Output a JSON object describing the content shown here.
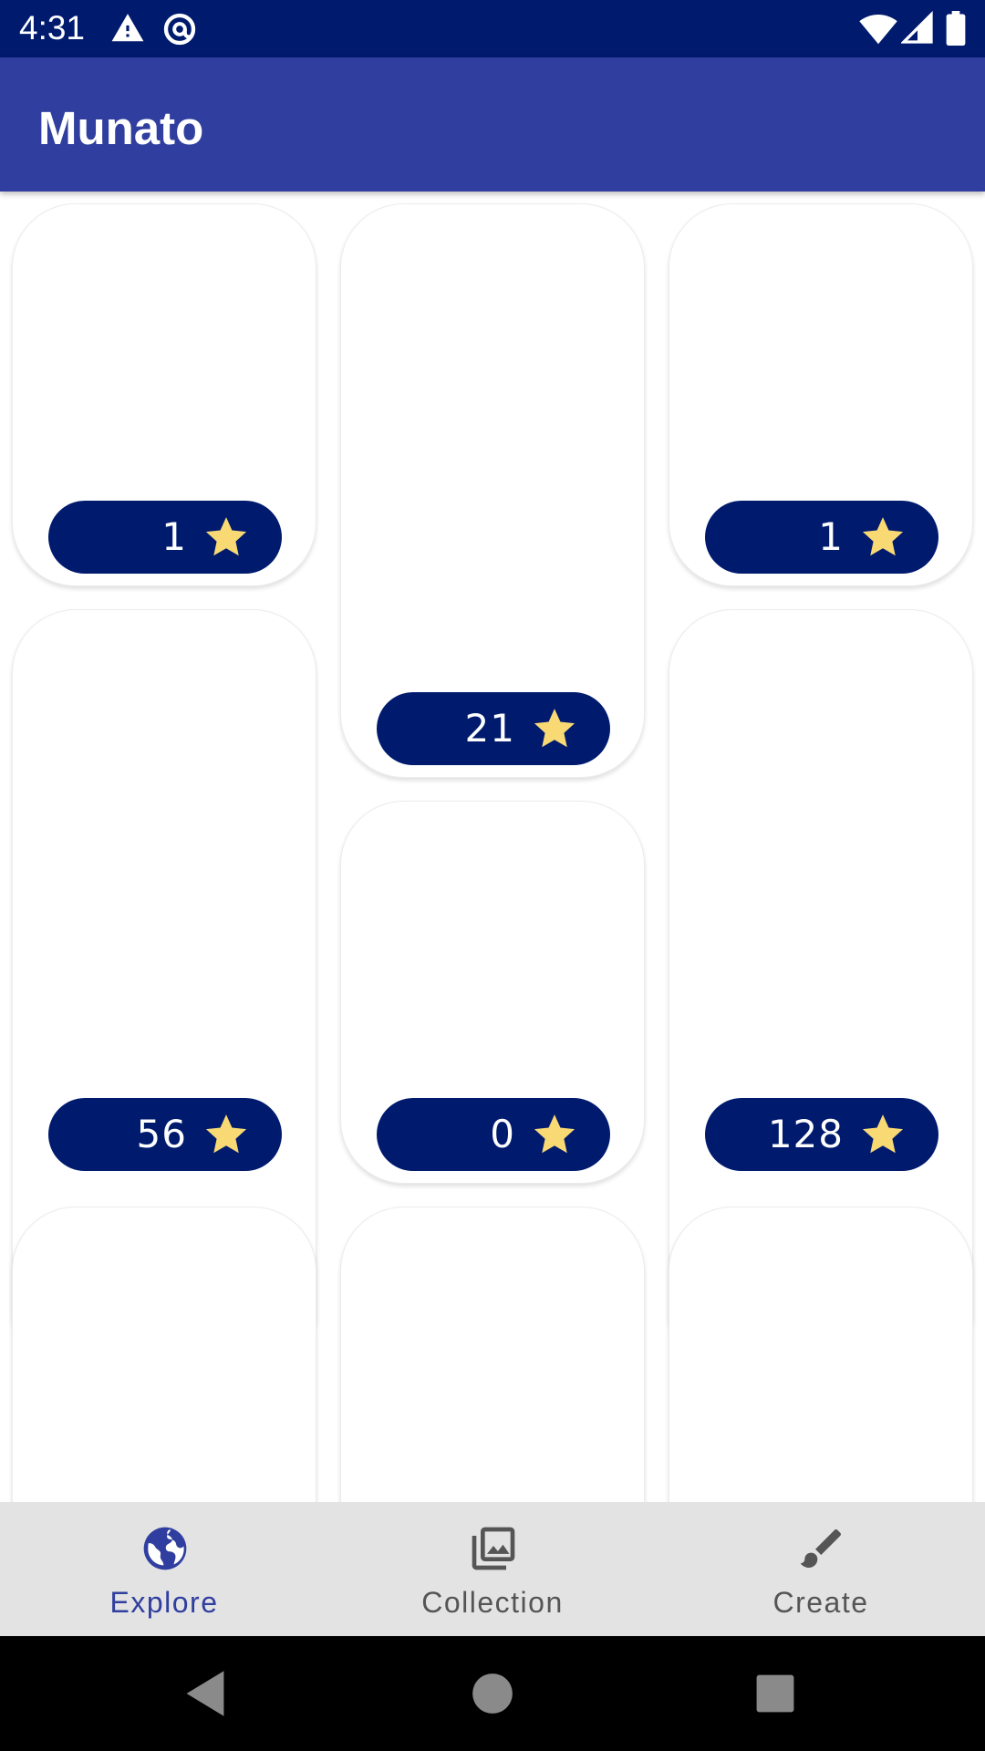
{
  "status_bar": {
    "time": "4:31",
    "left_icons": [
      "warning-icon",
      "at-sign-icon"
    ],
    "right_icons": [
      "wifi-icon",
      "cell-signal-icon",
      "battery-icon"
    ]
  },
  "app_bar": {
    "title": "Munato"
  },
  "cards": [
    {
      "count": "1"
    },
    {
      "count": "21"
    },
    {
      "count": "1"
    },
    {
      "count": "56"
    },
    {
      "count": "0"
    },
    {
      "count": "128"
    },
    {
      "count": ""
    },
    {
      "count": ""
    },
    {
      "count": ""
    }
  ],
  "bottom_nav": {
    "items": [
      {
        "label": "Explore",
        "icon": "globe-icon",
        "selected": true
      },
      {
        "label": "Collection",
        "icon": "photo-library-icon",
        "selected": false
      },
      {
        "label": "Create",
        "icon": "brush-icon",
        "selected": false
      }
    ]
  },
  "system_nav": {
    "buttons": [
      "back-icon",
      "home-icon",
      "recents-icon"
    ]
  },
  "colors": {
    "status_bar": "#001a6e",
    "app_bar": "#303f9f",
    "pill": "#001a6e",
    "star": "#f9d973",
    "nav_selected": "#303f9f",
    "nav_unselected": "#555555"
  }
}
